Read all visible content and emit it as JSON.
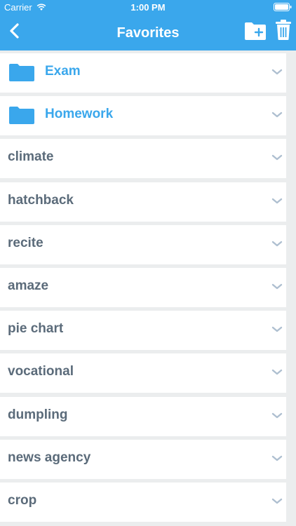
{
  "status": {
    "carrier": "Carrier",
    "time": "1:00 PM"
  },
  "nav": {
    "title": "Favorites"
  },
  "folders": [
    {
      "label": "Exam"
    },
    {
      "label": "Homework"
    }
  ],
  "words": [
    {
      "label": "climate"
    },
    {
      "label": "hatchback"
    },
    {
      "label": "recite"
    },
    {
      "label": "amaze"
    },
    {
      "label": "pie chart"
    },
    {
      "label": "vocational"
    },
    {
      "label": "dumpling"
    },
    {
      "label": "news agency"
    },
    {
      "label": "crop"
    }
  ],
  "colors": {
    "accent": "#3aa7ec",
    "text": "#5b6b7a",
    "chevron": "#aebfd0",
    "background": "#ebedee"
  },
  "icons": {
    "back": "chevron-left-icon",
    "add_folder": "folder-plus-icon",
    "delete": "trash-icon",
    "folder": "folder-icon",
    "expand": "chevron-down-icon"
  }
}
